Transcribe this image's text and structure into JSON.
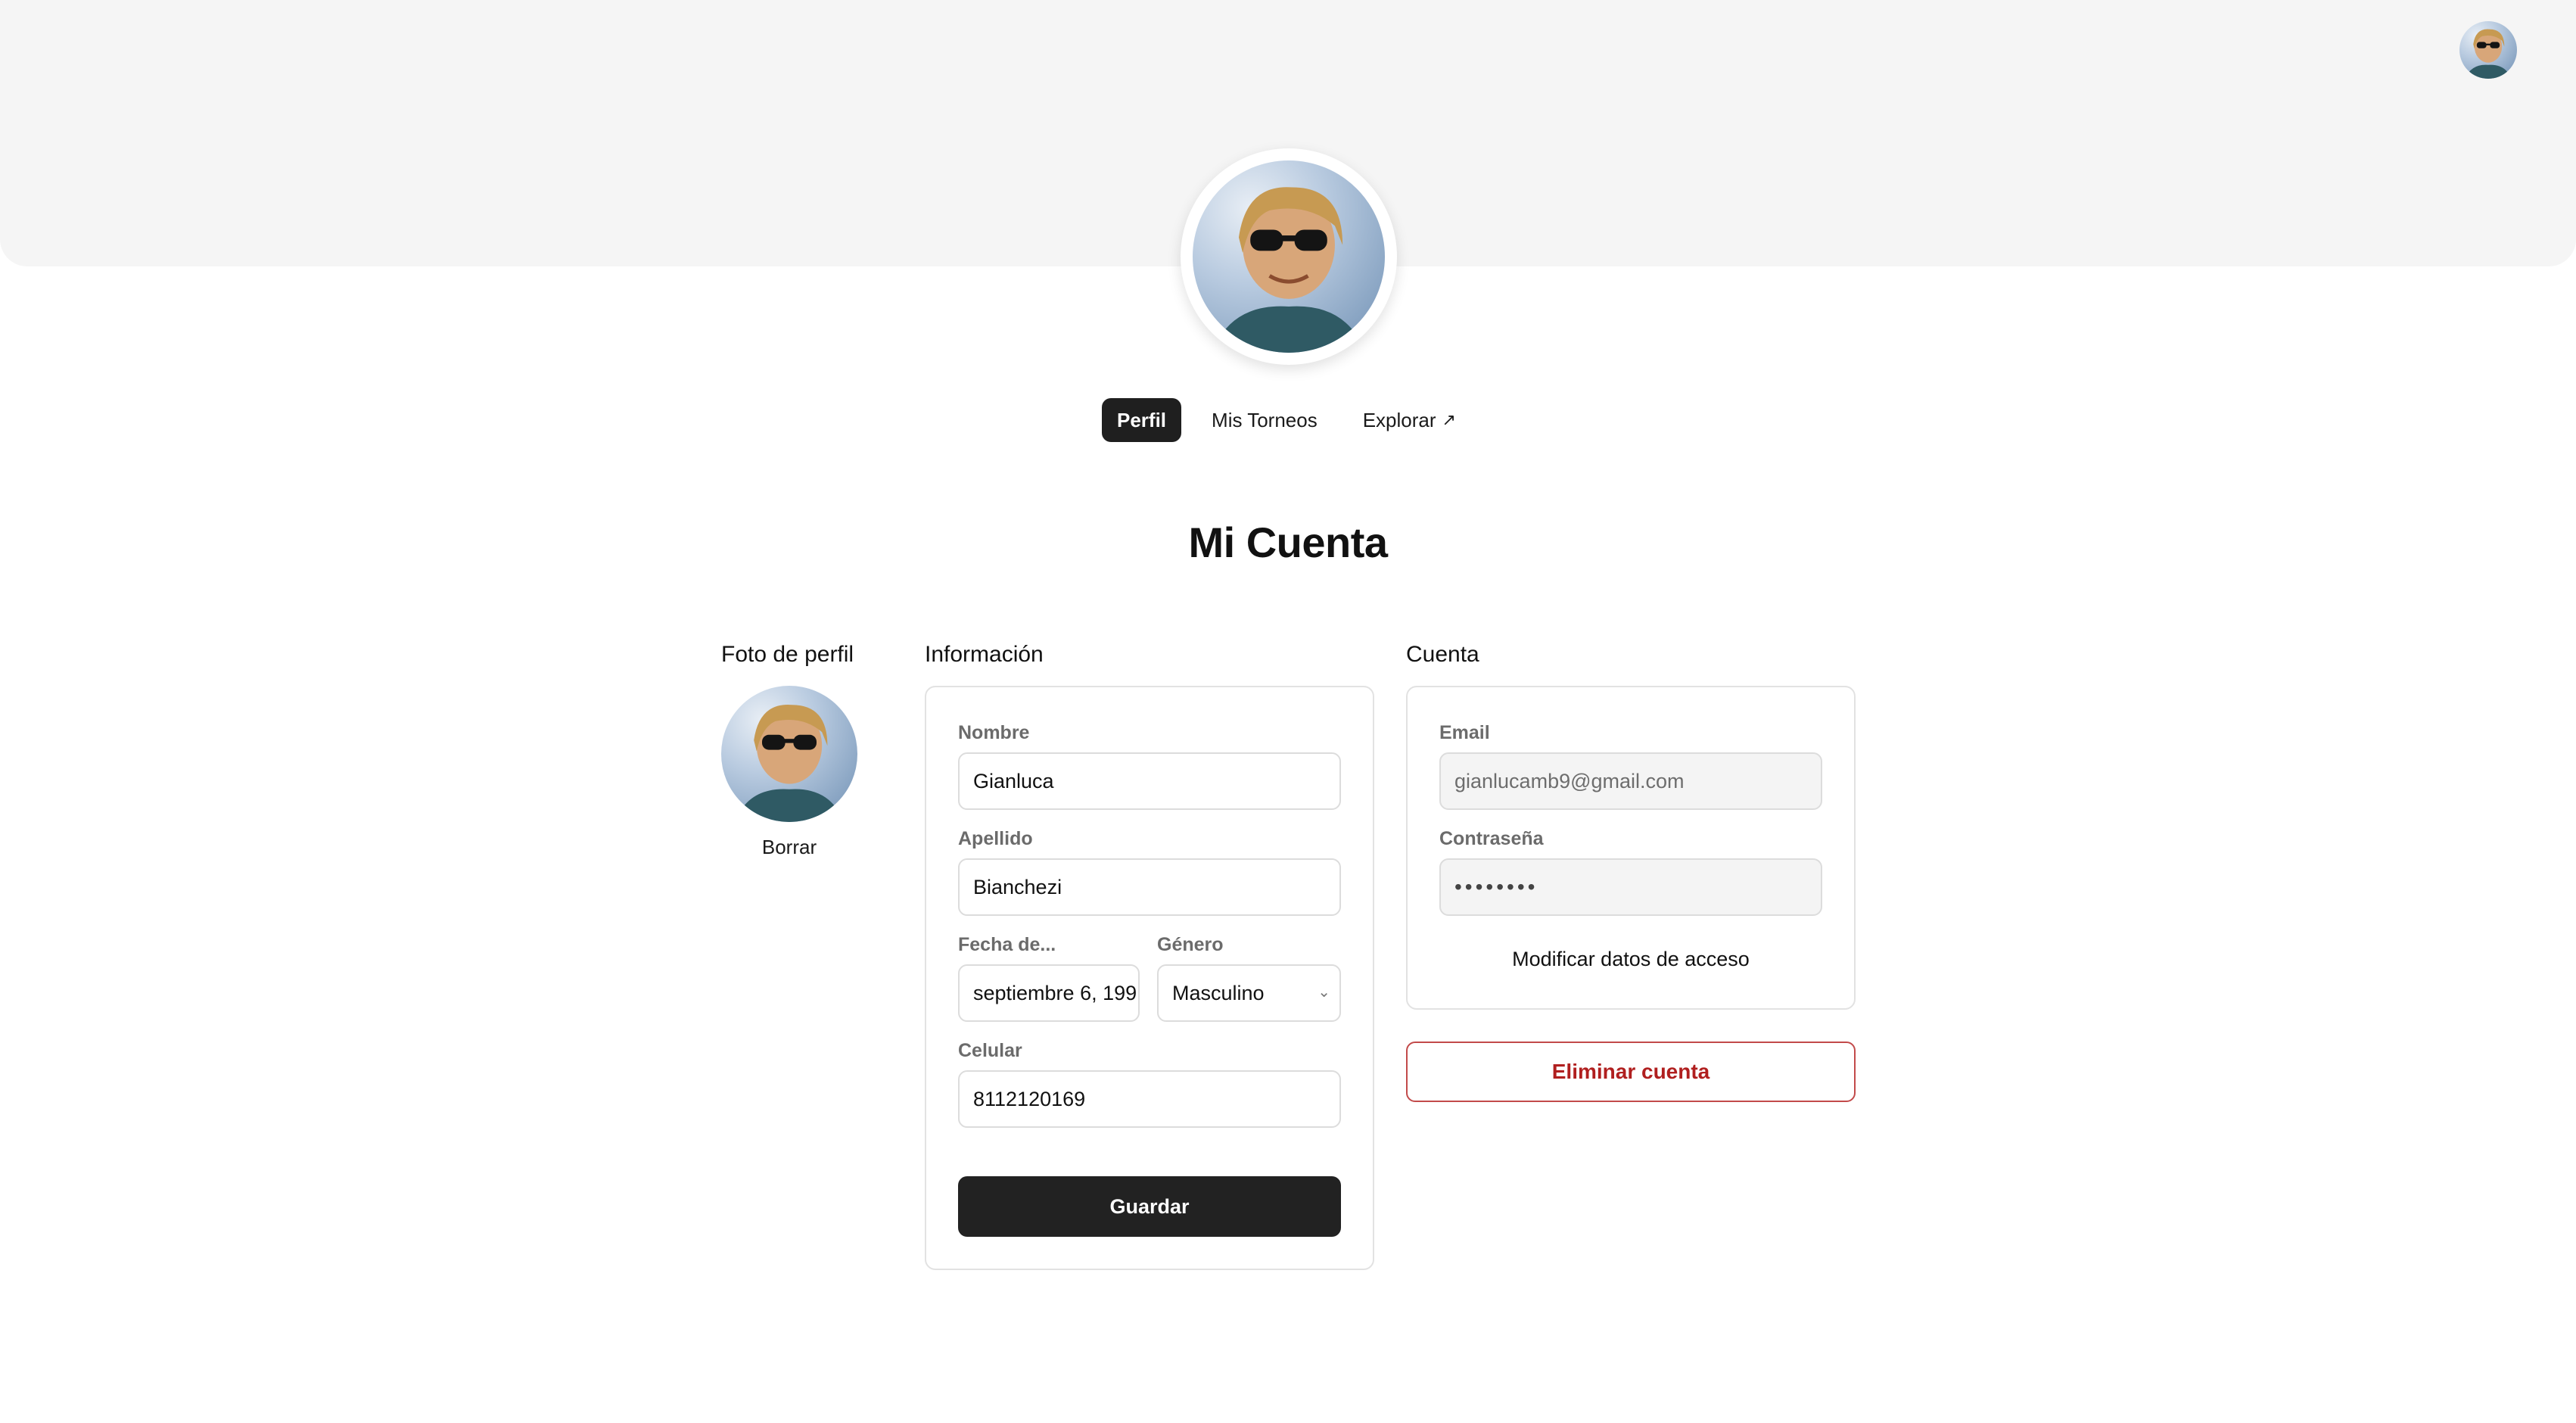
{
  "header": {
    "user_avatar_alt": "profile-photo"
  },
  "tabs": [
    {
      "label": "Perfil",
      "active": true
    },
    {
      "label": "Mis Torneos",
      "active": false
    },
    {
      "label": "Explorar",
      "active": false,
      "icon": "arrow-up-right-icon"
    }
  ],
  "page": {
    "title": "Mi Cuenta"
  },
  "photo": {
    "title": "Foto de perfil",
    "delete_label": "Borrar"
  },
  "info": {
    "title": "Información",
    "first_name_label": "Nombre",
    "first_name_value": "Gianluca",
    "last_name_label": "Apellido",
    "last_name_value": "Bianchezi",
    "birth_label": "Fecha de...",
    "birth_value": "septiembre 6, 199",
    "gender_label": "Género",
    "gender_value": "Masculino",
    "phone_label": "Celular",
    "phone_value": "8112120169",
    "save_label": "Guardar"
  },
  "account": {
    "title": "Cuenta",
    "email_label": "Email",
    "email_value": "gianlucamb9@gmail.com",
    "password_label": "Contraseña",
    "password_value": "••••••••",
    "modify_label": "Modificar datos de acceso",
    "delete_label": "Eliminar cuenta"
  },
  "colors": {
    "primary": "#222222",
    "danger": "#b01f1f",
    "banner": "#f5f5f5"
  }
}
